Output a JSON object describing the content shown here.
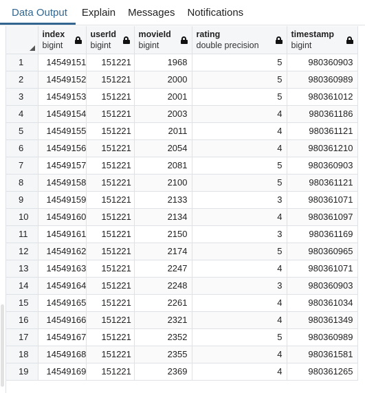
{
  "tabs": [
    {
      "label": "Data Output",
      "active": true
    },
    {
      "label": "Explain",
      "active": false
    },
    {
      "label": "Messages",
      "active": false
    },
    {
      "label": "Notifications",
      "active": false
    }
  ],
  "columns": [
    {
      "name": "index",
      "type": "bigint"
    },
    {
      "name": "userId",
      "type": "bigint"
    },
    {
      "name": "movieId",
      "type": "bigint"
    },
    {
      "name": "rating",
      "type": "double precision"
    },
    {
      "name": "timestamp",
      "type": "bigint"
    }
  ],
  "rows": [
    [
      "1",
      "14549151",
      "151221",
      "1968",
      "5",
      "980360903"
    ],
    [
      "2",
      "14549152",
      "151221",
      "2000",
      "5",
      "980360989"
    ],
    [
      "3",
      "14549153",
      "151221",
      "2001",
      "5",
      "980361012"
    ],
    [
      "4",
      "14549154",
      "151221",
      "2003",
      "4",
      "980361186"
    ],
    [
      "5",
      "14549155",
      "151221",
      "2011",
      "4",
      "980361121"
    ],
    [
      "6",
      "14549156",
      "151221",
      "2054",
      "4",
      "980361210"
    ],
    [
      "7",
      "14549157",
      "151221",
      "2081",
      "5",
      "980360903"
    ],
    [
      "8",
      "14549158",
      "151221",
      "2100",
      "5",
      "980361121"
    ],
    [
      "9",
      "14549159",
      "151221",
      "2133",
      "3",
      "980361071"
    ],
    [
      "10",
      "14549160",
      "151221",
      "2134",
      "4",
      "980361097"
    ],
    [
      "11",
      "14549161",
      "151221",
      "2150",
      "3",
      "980361169"
    ],
    [
      "12",
      "14549162",
      "151221",
      "2174",
      "5",
      "980360965"
    ],
    [
      "13",
      "14549163",
      "151221",
      "2247",
      "4",
      "980361071"
    ],
    [
      "14",
      "14549164",
      "151221",
      "2248",
      "3",
      "980360903"
    ],
    [
      "15",
      "14549165",
      "151221",
      "2261",
      "4",
      "980361034"
    ],
    [
      "16",
      "14549166",
      "151221",
      "2321",
      "4",
      "980361349"
    ],
    [
      "17",
      "14549167",
      "151221",
      "2352",
      "5",
      "980360989"
    ],
    [
      "18",
      "14549168",
      "151221",
      "2355",
      "4",
      "980361581"
    ],
    [
      "19",
      "14549169",
      "151221",
      "2369",
      "4",
      "980361265"
    ]
  ],
  "colors": {
    "accent": "#326690",
    "header_bg": "#f5f6f8",
    "border": "#dee2e6"
  }
}
